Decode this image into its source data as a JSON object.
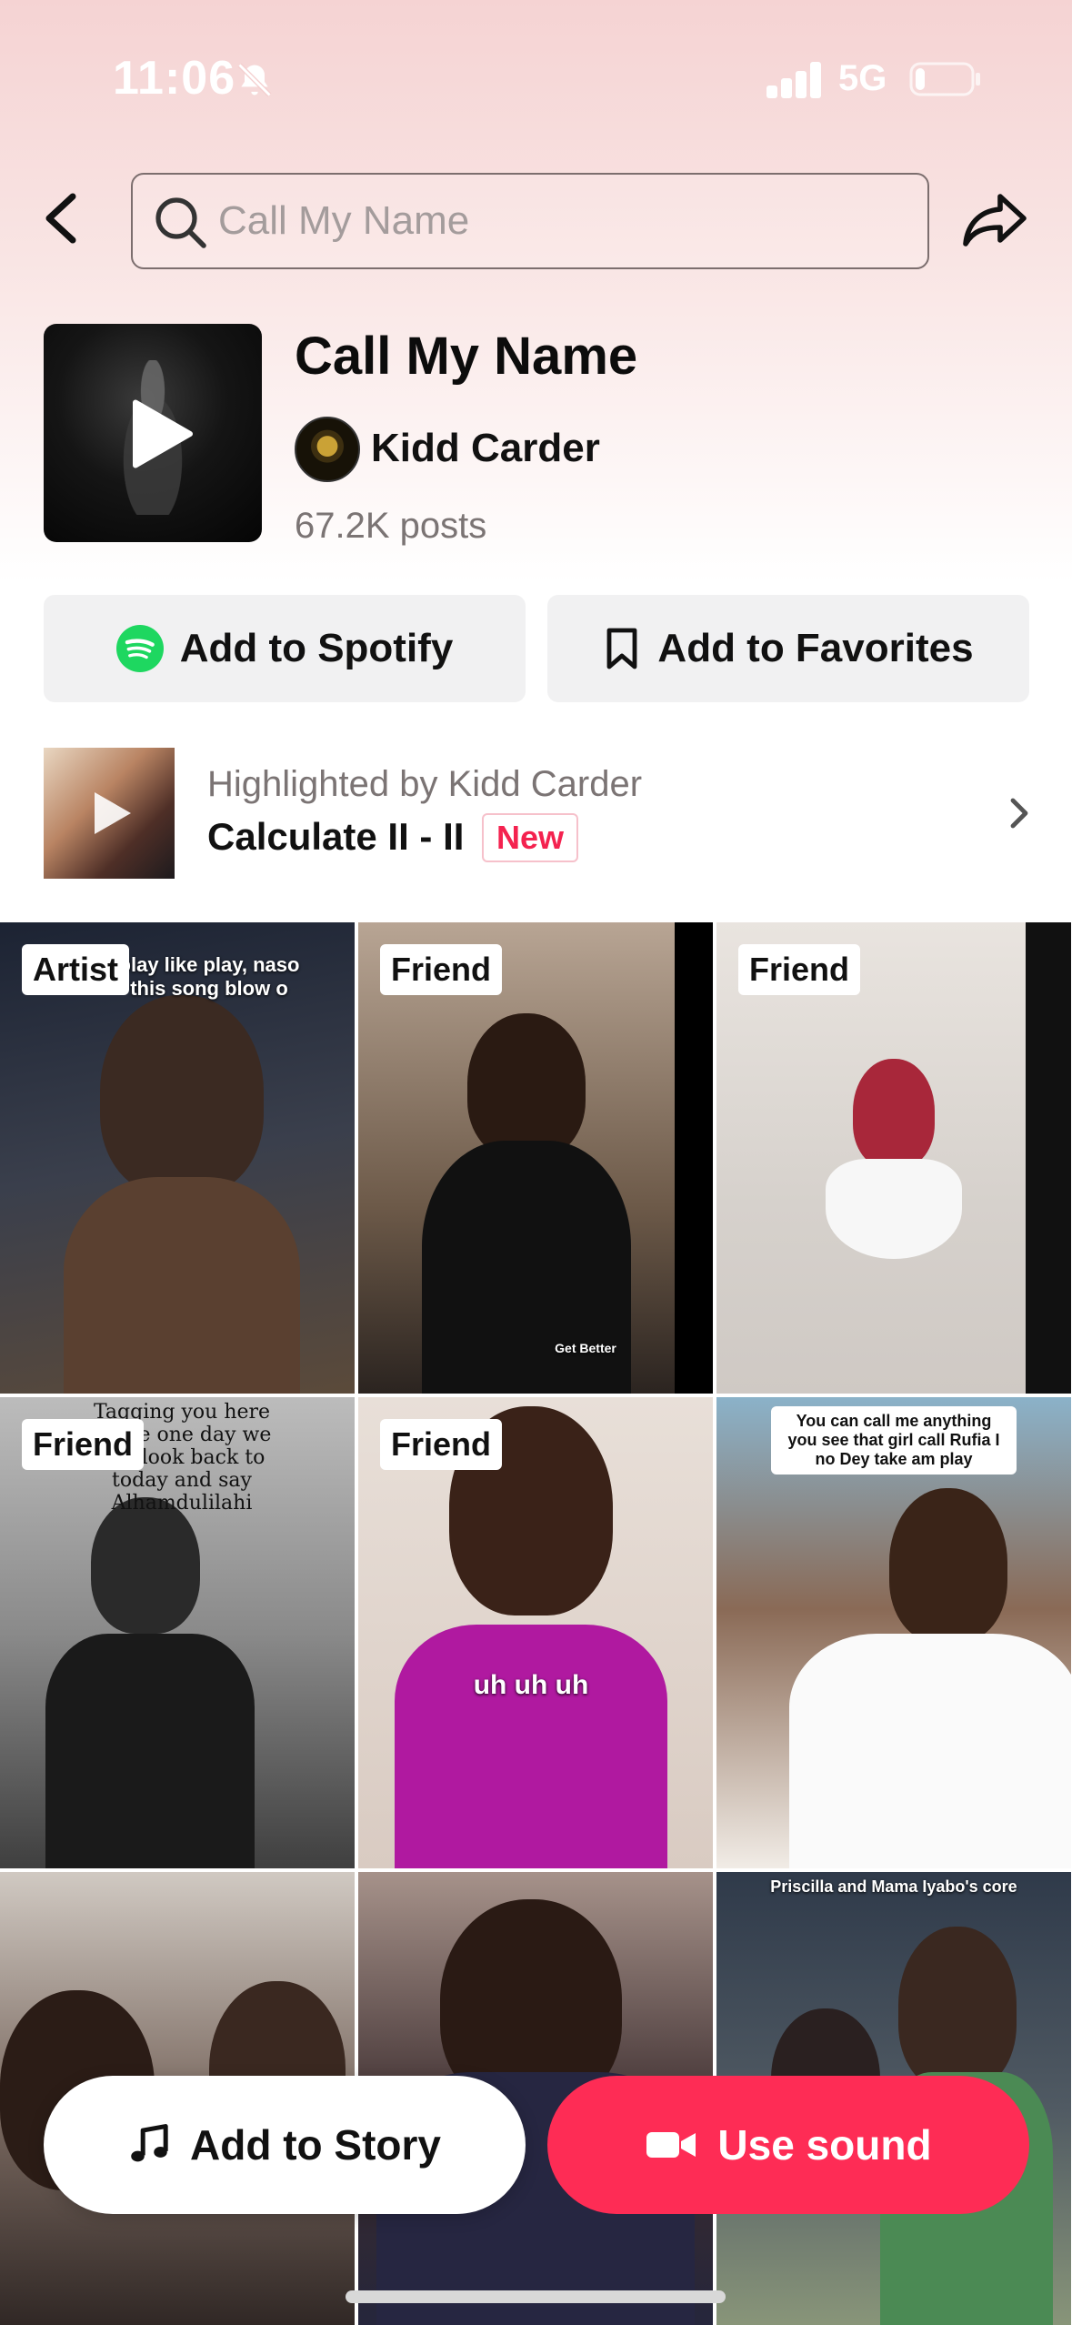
{
  "status_bar": {
    "time": "11:06",
    "network": "5G"
  },
  "search": {
    "query": "Call My Name"
  },
  "sound": {
    "title": "Call My Name",
    "artist": "Kidd Carder",
    "posts": "67.2K posts"
  },
  "actions": {
    "spotify": "Add to Spotify",
    "favorites": "Add to Favorites"
  },
  "highlight": {
    "by": "Highlighted by Kidd Carder",
    "title": "Calculate II - II",
    "badge": "New"
  },
  "videos": [
    {
      "tag": "Artist",
      "caption": "play like play, naso this song blow o"
    },
    {
      "tag": "Friend",
      "caption": "Get Better"
    },
    {
      "tag": "Friend",
      "caption": ""
    },
    {
      "tag": "Friend",
      "caption": "Tagging you here cause one day we will look back to today and say Alhamdulilahi"
    },
    {
      "tag": "Friend",
      "caption": "uh uh uh"
    },
    {
      "tag": "",
      "caption": "You can call me anything you see that girl call Rufia I no Dey take am play"
    },
    {
      "tag": "",
      "caption": ""
    },
    {
      "tag": "",
      "caption": ""
    },
    {
      "tag": "",
      "caption": "Priscilla and Mama Iyabo's core"
    }
  ],
  "bottom": {
    "add_to_story": "Add to Story",
    "use_sound": "Use sound"
  },
  "colors": {
    "accent": "#fe2c55",
    "spotify": "#1ed760",
    "badge_text": "#f4224f"
  }
}
